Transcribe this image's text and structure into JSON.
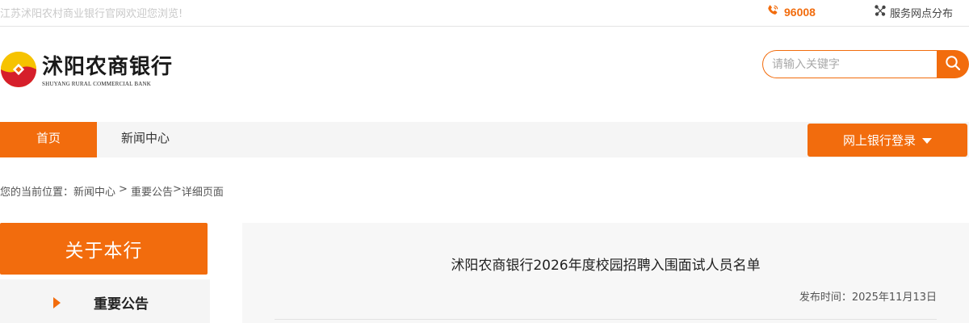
{
  "topbar": {
    "welcome": "江苏沭阳农村商业银行官网欢迎您浏览!",
    "hotline": "96008",
    "branches_label": "服务网点分布",
    "icons": {
      "phone": "phone-icon",
      "branches": "network-nodes-icon"
    }
  },
  "header": {
    "logo_cn": "沭阳农商银行",
    "logo_en": "SHUYANG RURAL COMMERCIAL BANK",
    "search_placeholder": "请输入关键字",
    "search_icon": "search-icon"
  },
  "nav": {
    "items": [
      {
        "label": "首页",
        "active": true
      },
      {
        "label": "新闻中心",
        "active": false
      }
    ],
    "ebank_label": "网上银行登录"
  },
  "breadcrumb": {
    "prefix": "您的当前位置：",
    "items": [
      "新闻中心",
      "重要公告",
      "详细页面"
    ],
    "separators": [
      ">",
      ">"
    ]
  },
  "sidebar": {
    "heading": "关于本行",
    "items": [
      {
        "label": "重要公告"
      }
    ]
  },
  "article": {
    "title": "沭阳农商银行2026年度校园招聘入围面试人员名单",
    "date_label": "发布时间：",
    "date_value": "2025年11月13日"
  },
  "colors": {
    "accent": "#f26c0d",
    "nav_bg": "#f5f5f5",
    "content_bg": "#f7f7f7"
  }
}
